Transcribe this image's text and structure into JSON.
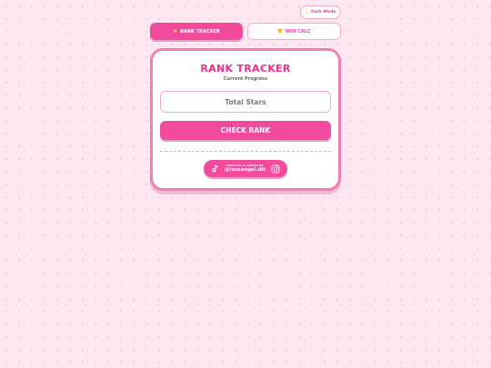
{
  "header": {
    "dark_mode_label": "Dark Mode",
    "dark_mode_icon": "moon-icon"
  },
  "tabs": [
    {
      "label": "RANK TRACKER",
      "icon": "star-icon",
      "active": true
    },
    {
      "label": "WIN CALC",
      "icon": "trophy-icon",
      "active": false
    }
  ],
  "tracker": {
    "title": "RANK TRACKER",
    "subtitle": "Current Progress",
    "stars_placeholder": "Total Stars",
    "stars_value": "",
    "check_button_label": "CHECK RANK"
  },
  "credit": {
    "prefix": "CREATED & CODED BY",
    "handle": "@lassangel.dti",
    "icons": [
      "tiktok-icon",
      "instagram-icon"
    ]
  },
  "colors": {
    "accent": "#f24a9c",
    "title": "#e8318b",
    "background": "#fde8f1",
    "border": "#f3a9c8"
  }
}
